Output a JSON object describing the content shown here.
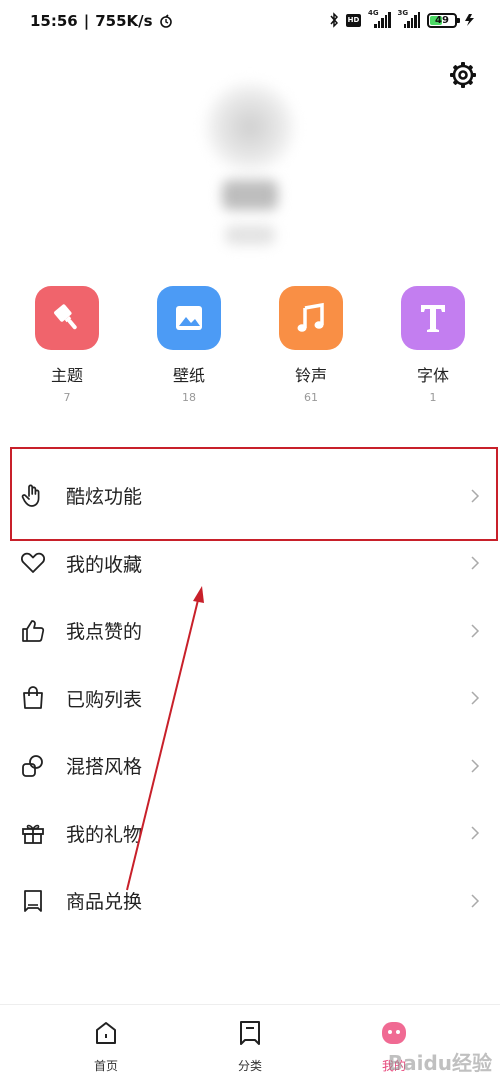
{
  "status_bar": {
    "time": "15:56",
    "speed": "755K/s",
    "signal1_label": "4G",
    "signal2_label": "3G",
    "hd_label": "HD",
    "battery": "49",
    "battery_fraction": 0.49
  },
  "categories": [
    {
      "name": "主题",
      "count": "7",
      "icon": "paint-brush-icon",
      "color": "#f0646c"
    },
    {
      "name": "壁纸",
      "count": "18",
      "icon": "image-icon",
      "color": "#4c9bf5"
    },
    {
      "name": "铃声",
      "count": "61",
      "icon": "music-note-icon",
      "color": "#f98f45"
    },
    {
      "name": "字体",
      "count": "1",
      "icon": "font-t-icon",
      "color": "#c37ef0"
    }
  ],
  "menu": [
    {
      "label": "酷炫功能",
      "icon": "hand-gesture-icon"
    },
    {
      "label": "我的收藏",
      "icon": "heart-icon"
    },
    {
      "label": "我点赞的",
      "icon": "thumbs-up-icon"
    },
    {
      "label": "已购列表",
      "icon": "shopping-bag-icon"
    },
    {
      "label": "混搭风格",
      "icon": "mix-style-icon"
    },
    {
      "label": "我的礼物",
      "icon": "gift-icon"
    },
    {
      "label": "商品兑换",
      "icon": "exchange-card-icon"
    }
  ],
  "nav": [
    {
      "label": "首页",
      "icon": "home-icon"
    },
    {
      "label": "分类",
      "icon": "category-icon"
    },
    {
      "label": "我的",
      "icon": "profile-face-icon",
      "active": true
    }
  ],
  "annotation": {
    "highlight_color": "#c8202a"
  },
  "watermark": "Baidu经验"
}
